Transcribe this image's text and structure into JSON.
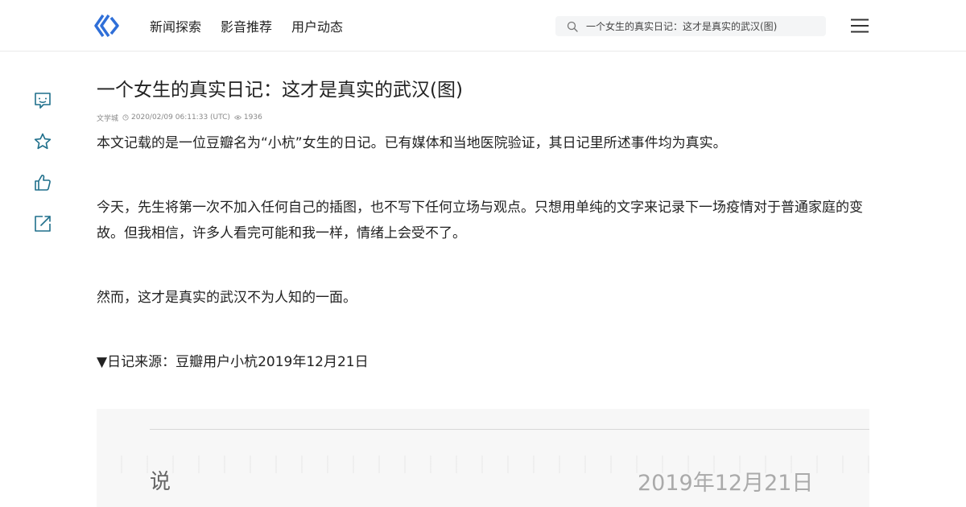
{
  "header": {
    "nav": [
      "新闻探索",
      "影音推荐",
      "用户动态"
    ],
    "search_placeholder": "一个女生的真实日记：这才是真实的武汉(图)"
  },
  "side_actions": [
    "comment-icon",
    "star-icon",
    "thumbs-up-icon",
    "share-icon"
  ],
  "article": {
    "title": "一个女生的真实日记：这才是真实的武汉(图)",
    "source": "文学城",
    "datetime": "2020/02/09 06:11:33 (UTC)",
    "views": "1936",
    "paragraphs": [
      "本文记载的是一位豆瓣名为“小杭”女生的日记。已有媒体和当地医院验证，其日记里所述事件均为真实。",
      "今天，先生将第一次不加入任何自己的插图，也不写下任何立场与观点。只想用单纯的文字来记录下一场疫情对于普通家庭的变故。但我相信，许多人看完可能和我一样，情绪上会受不了。",
      "然而，这才是真实的武汉不为人知的一面。",
      "▼日记来源：豆瓣用户小杭2019年12月21日"
    ],
    "image_text_left": "说",
    "image_text_date": "2019年12月21日"
  },
  "colors": {
    "brand": "#2f6fd8",
    "icon": "#1f6f8b"
  }
}
